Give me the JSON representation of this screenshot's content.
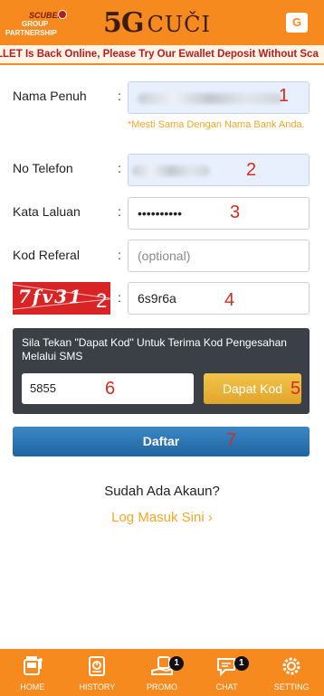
{
  "header": {
    "partner_logo": {
      "line1": "SCUBEN",
      "line2": "GROUP",
      "line3": "PARTNERSHIP"
    },
    "brand_5g": "5G",
    "brand_name": "CUČI",
    "translate_icon": "google-translate-icon",
    "translate_label": "G"
  },
  "announcement": "LLET Is Back Online, Please Try Our Ewallet Deposit Without Sca",
  "form": {
    "full_name": {
      "label": "Nama Penuh",
      "colon": ":",
      "annotation": "1"
    },
    "name_hint": "*Mesti Sama Dengan Nama Bank Anda.",
    "phone": {
      "label": "No Telefon",
      "colon": ":",
      "annotation": "2"
    },
    "password": {
      "label": "Kata Laluan",
      "colon": ":",
      "value": "••••••••••",
      "annotation": "3"
    },
    "referral": {
      "label": "Kod Referal",
      "colon": ":",
      "placeholder": "(optional)"
    },
    "captcha": {
      "image_text": "7fv31",
      "annotation_on_image": "2",
      "colon": ":",
      "value": "6s9r6a",
      "annotation": "4"
    }
  },
  "sms": {
    "message": "Sila Tekan \"Dapat Kod\" Untuk Terima Kod Pengesahan Melalui SMS",
    "code_value": "5855",
    "code_annotation": "6",
    "get_code_label": "Dapat Kod",
    "get_code_annotation": "5"
  },
  "register": {
    "label": "Daftar",
    "annotation": "7"
  },
  "login_prompt": "Sudah Ada Akaun?",
  "login_link": "Log Masuk Sini",
  "login_chevron": "›",
  "bottom_nav": [
    {
      "label": "HOME",
      "icon": "slot-machine-icon"
    },
    {
      "label": "HISTORY",
      "icon": "history-book-icon"
    },
    {
      "label": "PROMO",
      "icon": "promo-gift-icon",
      "badge": "1"
    },
    {
      "label": "CHAT",
      "icon": "chat-bubble-icon",
      "badge": "1"
    },
    {
      "label": "SETTING",
      "icon": "gear-icon"
    }
  ],
  "colors": {
    "primary": "#f68a1f",
    "accent": "#f5a623",
    "button_blue": "#1f64a1",
    "annotation_red": "#d62b1f"
  }
}
